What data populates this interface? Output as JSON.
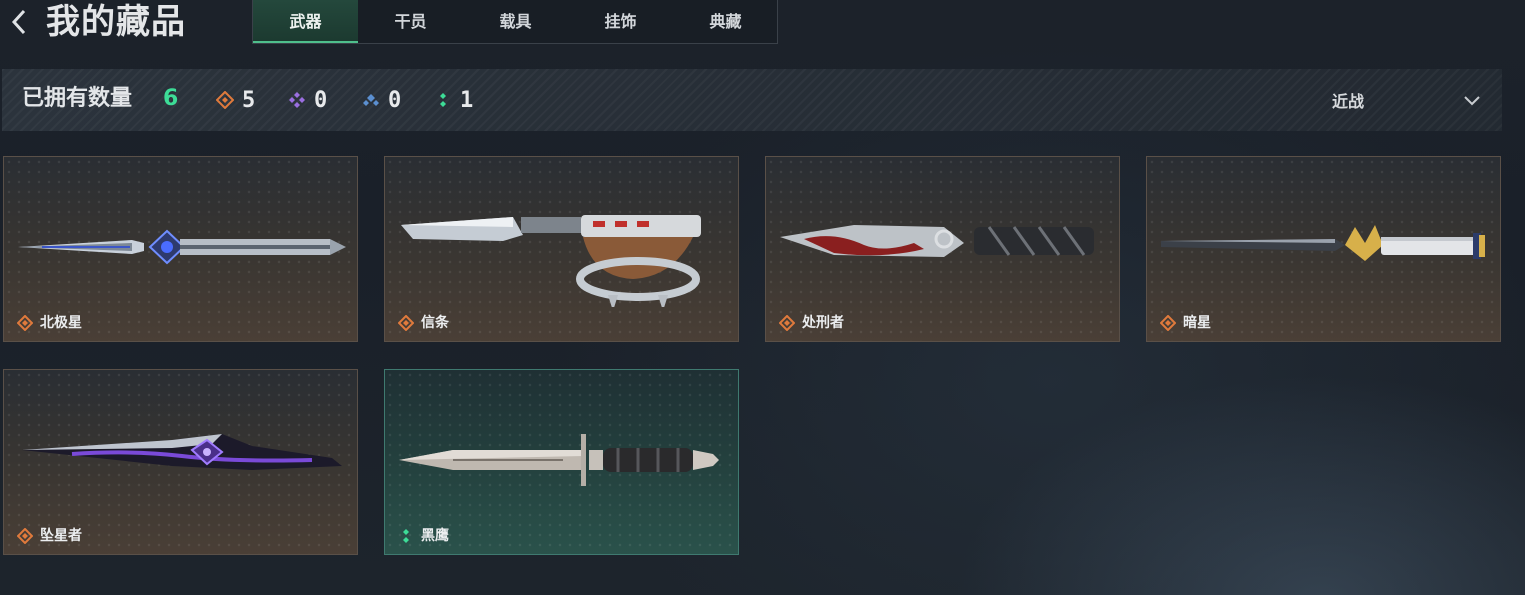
{
  "header": {
    "back_icon": "chevron-left-icon",
    "title": "我的藏品",
    "tabs": [
      {
        "label": "武器",
        "active": true
      },
      {
        "label": "干员",
        "active": false
      },
      {
        "label": "载具",
        "active": false
      },
      {
        "label": "挂饰",
        "active": false
      },
      {
        "label": "典藏",
        "active": false
      }
    ]
  },
  "stats": {
    "owned_label": "已拥有数量",
    "owned_count": "6",
    "rarity_counts": [
      {
        "icon": "orange-diamond-icon",
        "color": "#e07a3c",
        "value": "5"
      },
      {
        "icon": "purple-diamond-icon",
        "color": "#9a6ee0",
        "value": "0"
      },
      {
        "icon": "blue-diamond-icon",
        "color": "#5b8fd0",
        "value": "0"
      },
      {
        "icon": "green-dots-icon",
        "color": "#3ddc97",
        "value": "1"
      }
    ],
    "filter": {
      "label": "近战",
      "icon": "chevron-down-icon"
    }
  },
  "items": [
    {
      "name": "北极星",
      "rarity": "orange",
      "rarity_icon": "orange-diamond-icon"
    },
    {
      "name": "信条",
      "rarity": "orange",
      "rarity_icon": "orange-diamond-icon"
    },
    {
      "name": "处刑者",
      "rarity": "orange",
      "rarity_icon": "orange-diamond-icon"
    },
    {
      "name": "暗星",
      "rarity": "orange",
      "rarity_icon": "orange-diamond-icon"
    },
    {
      "name": "坠星者",
      "rarity": "orange",
      "rarity_icon": "orange-diamond-icon"
    },
    {
      "name": "黑鹰",
      "rarity": "green",
      "rarity_icon": "green-dots-icon"
    }
  ],
  "colors": {
    "accent_green": "#3ddc97",
    "rarity_orange": "#e07a3c",
    "rarity_purple": "#9a6ee0",
    "rarity_blue": "#5b8fd0"
  }
}
